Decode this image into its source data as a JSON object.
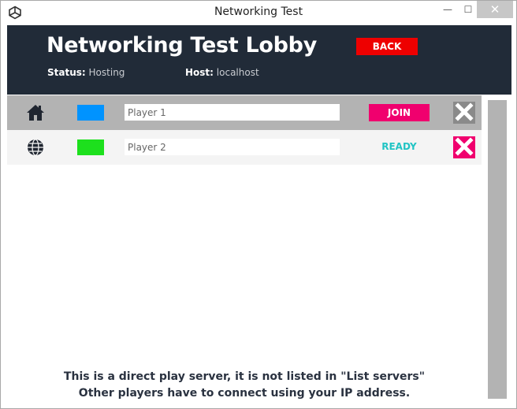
{
  "window": {
    "title": "Networking Test",
    "minimize_glyph": "—",
    "maximize_glyph": "☐",
    "close_glyph": "✕"
  },
  "header": {
    "title": "Networking Test Lobby",
    "back_label": "BACK",
    "status_label": "Status:",
    "status_value": "Hosting",
    "host_label": "Host:",
    "host_value": "localhost",
    "back_color": "#ee0000",
    "background_color": "#212b38"
  },
  "players": [
    {
      "icon": "home-icon",
      "color": "#0093ff",
      "name": "Player 1",
      "action_label": "JOIN",
      "action_color": "#f0006e",
      "remove_color": "#8a8a8a"
    },
    {
      "icon": "globe-icon",
      "color": "#1de01d",
      "name": "Player 2",
      "status_label": "READY",
      "status_color": "#22c4c4",
      "remove_color": "#f0006e"
    }
  ],
  "info": {
    "line1": "This is a direct play server, it is not listed in \"List servers\"",
    "line2": "Other players have to connect using your IP address."
  }
}
